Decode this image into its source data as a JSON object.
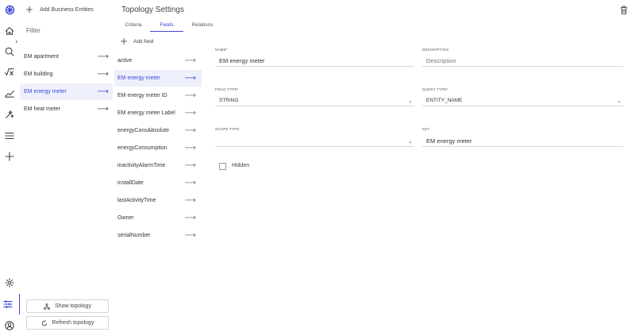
{
  "rail": {
    "icons": [
      "logo-icon",
      "home-icon",
      "search-icon",
      "formula-icon",
      "trend-icon",
      "magic-icon",
      "menu-icon",
      "plus-icon",
      "gear-icon",
      "sliders-icon",
      "user-icon"
    ]
  },
  "be_panel": {
    "add_label": "Add Business Entities",
    "filter_title": "Filter",
    "items": [
      {
        "label": "EM apartment",
        "active": false
      },
      {
        "label": "EM building",
        "active": false
      },
      {
        "label": "EM energy meter",
        "active": true
      },
      {
        "label": "EM heat meter",
        "active": false
      }
    ],
    "show_topology": "Show topology",
    "refresh_topology": "Refresh topology"
  },
  "settings": {
    "title": "Topology Settings",
    "tabs": [
      {
        "label": "Criteria",
        "active": false
      },
      {
        "label": "Fields",
        "active": true
      },
      {
        "label": "Relations",
        "active": false
      }
    ],
    "add_field_label": "Add field",
    "fields": [
      {
        "label": "active",
        "active": false
      },
      {
        "label": "EM energy meter",
        "active": true
      },
      {
        "label": "EM energy meter ID",
        "active": false
      },
      {
        "label": "EM energy meter Label",
        "active": false
      },
      {
        "label": "energyConsAbsolute",
        "active": false
      },
      {
        "label": "energyConsumption",
        "active": false
      },
      {
        "label": "inactivityAlarmTime",
        "active": false
      },
      {
        "label": "installDate",
        "active": false
      },
      {
        "label": "lastActivityTime",
        "active": false
      },
      {
        "label": "Owner",
        "active": false
      },
      {
        "label": "serialNumber",
        "active": false
      }
    ]
  },
  "form": {
    "name_label": "Name*",
    "name_value": "EM energy meter",
    "description_label": "Description",
    "description_placeholder": "Description",
    "field_type_label": "Field type*",
    "field_type_value": "STRING",
    "query_type_label": "Query type*",
    "query_type_value": "ENTITY_NAME",
    "scope_type_label": "Scope type",
    "scope_type_value": "",
    "key_label": "Key",
    "key_value": "EM energy meter",
    "hidden_label": "Hidden",
    "hidden_checked": false
  },
  "colors": {
    "accent": "#3c4ad8",
    "active_bg": "#eef0fb"
  }
}
